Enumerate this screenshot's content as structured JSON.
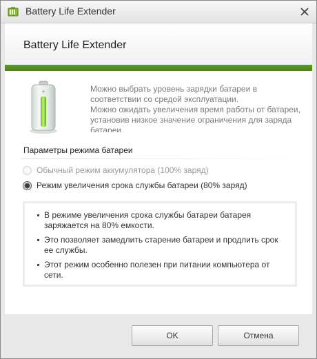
{
  "window": {
    "title": "Battery Life Extender",
    "app_icon": "battery-icon",
    "close_icon": "close-icon"
  },
  "header": {
    "title": "Battery Life Extender",
    "accent_color": "#5a961c"
  },
  "description": {
    "line1": "Можно выбрать уровень зарядки батареи в соответствии со средой эксплуатации.",
    "line2": "Можно ожидать увеличения время работы от батареи, установив низкое значение ограничения для заряда батареи."
  },
  "battery_mode": {
    "group_title": "Параметры режима батареи",
    "options": [
      {
        "label": "Обычный режим аккумулятора (100% заряд)",
        "selected": false
      },
      {
        "label": "Режим увеличения срока службы батареи (80% заряд)",
        "selected": true
      }
    ]
  },
  "info": {
    "items": [
      "В режиме увеличения срока службы батареи батарея заряжается на 80% емкости.",
      "Это позволяет замедлить старение батареи и продлить срок ее службы.",
      "Этот режим особенно полезен при питании компьютера от сети."
    ]
  },
  "buttons": {
    "ok": "OK",
    "cancel": "Отмена"
  }
}
